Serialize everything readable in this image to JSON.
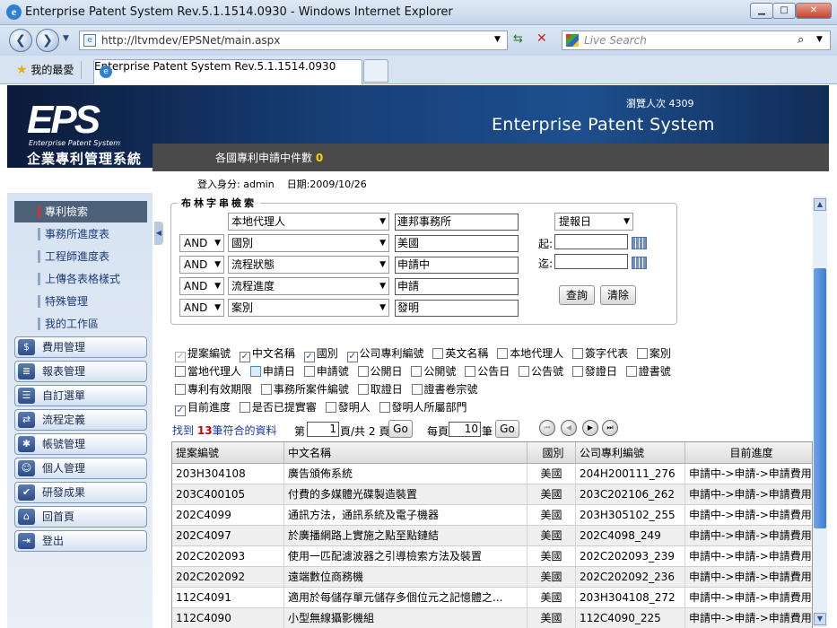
{
  "window": {
    "title": "Enterprise Patent System Rev.5.1.1514.0930 - Windows Internet Explorer",
    "url": "http://ltvmdev/EPSNet/main.aspx",
    "search_placeholder": "Live Search",
    "favorites_label": "我的最愛",
    "tab_title": "Enterprise Patent System Rev.5.1.1514.0930"
  },
  "header": {
    "logo_text": "EPS",
    "logo_subtitle": "Enterprise Patent System",
    "system_name_cn": "企業專利管理系統",
    "visits_label": "瀏覽人次",
    "visits_count": "4309",
    "system_name_en": "Enterprise Patent System",
    "apply_label": "各國專利申請中件數",
    "apply_count": "0",
    "login_label": "登入身分:",
    "login_user": "admin",
    "date_label": "日期:",
    "date_value": "2009/10/26"
  },
  "sidebar": {
    "sub_items": [
      "專利檢索",
      "事務所進度表",
      "工程師進度表",
      "上傳各表格樣式",
      "特殊管理",
      "我的工作區"
    ],
    "main_items": [
      {
        "label": "費用管理",
        "icon": "dollar-icon"
      },
      {
        "label": "報表管理",
        "icon": "report-icon"
      },
      {
        "label": "自訂選單",
        "icon": "custom-menu-icon"
      },
      {
        "label": "流程定義",
        "icon": "flow-icon"
      },
      {
        "label": "帳號管理",
        "icon": "account-icon"
      },
      {
        "label": "個人管理",
        "icon": "person-icon"
      },
      {
        "label": "研發成果",
        "icon": "thumbs-up-icon"
      },
      {
        "label": "回首頁",
        "icon": "home-icon"
      },
      {
        "label": "登出",
        "icon": "logout-icon"
      }
    ]
  },
  "search": {
    "title": "布林字串檢索",
    "rows": [
      {
        "op": "",
        "field": "本地代理人",
        "value": "連邦事務所"
      },
      {
        "op": "AND",
        "field": "國別",
        "value": "美國"
      },
      {
        "op": "AND",
        "field": "流程狀態",
        "value": "申請中"
      },
      {
        "op": "AND",
        "field": "流程進度",
        "value": "申請"
      },
      {
        "op": "AND",
        "field": "案別",
        "value": "發明"
      }
    ],
    "date_field": "提報日",
    "from_label": "起:",
    "to_label": "迄:",
    "query_button": "查詢",
    "clear_button": "清除"
  },
  "columns_options": [
    {
      "label": "提案編號",
      "checked": true,
      "disabled": true
    },
    {
      "label": "中文名稱",
      "checked": true
    },
    {
      "label": "國別",
      "checked": true
    },
    {
      "label": "公司專利編號",
      "checked": true
    },
    {
      "label": "英文名稱",
      "checked": false
    },
    {
      "label": "本地代理人",
      "checked": false
    },
    {
      "label": "簽字代表",
      "checked": false
    },
    {
      "label": "案別",
      "checked": false
    },
    {
      "label": "當地代理人",
      "checked": false
    },
    {
      "label": "申請日",
      "checked": false,
      "highlight": true
    },
    {
      "label": "申請號",
      "checked": false
    },
    {
      "label": "公開日",
      "checked": false
    },
    {
      "label": "公開號",
      "checked": false
    },
    {
      "label": "公告日",
      "checked": false
    },
    {
      "label": "公告號",
      "checked": false
    },
    {
      "label": "發證日",
      "checked": false
    },
    {
      "label": "證書號",
      "checked": false
    },
    {
      "label": "專利有效期限",
      "checked": false
    },
    {
      "label": "事務所案件編號",
      "checked": false
    },
    {
      "label": "取證日",
      "checked": false
    },
    {
      "label": "證書卷宗號",
      "checked": false
    },
    {
      "label": "目前進度",
      "checked": true
    },
    {
      "label": "是否已提實審",
      "checked": false
    },
    {
      "label": "發明人",
      "checked": false
    },
    {
      "label": "發明人所屬部門",
      "checked": false
    }
  ],
  "results": {
    "found_prefix": "找到",
    "found_count": "13",
    "found_suffix": "筆符合的資料",
    "page_prefix": "第",
    "page_value": "1",
    "page_mid": "頁/共",
    "page_total": "2",
    "page_suffix": "頁",
    "go_label": "Go",
    "per_prefix": "每頁",
    "per_value": "10",
    "per_suffix": "筆",
    "headers": [
      "提案編號",
      "中文名稱",
      "國別",
      "公司專利編號",
      "目前進度"
    ],
    "rows": [
      [
        "203H304108",
        "廣告頒佈系統",
        "美國",
        "204H200111_276",
        "申請中->申請->申請費用"
      ],
      [
        "203C400105",
        "付費的多媒體光碟製造裝置",
        "美國",
        "203C202106_262",
        "申請中->申請->申請費用"
      ],
      [
        "202C4099",
        "通訊方法，通訊系統及電子機器",
        "美國",
        "203H305102_255",
        "申請中->申請->申請費用"
      ],
      [
        "202C4097",
        "於廣播網路上實施之點至點鏈結",
        "美國",
        "202C4098_249",
        "申請中->申請->申請費用"
      ],
      [
        "202C202093",
        "使用一匹配濾波器之引導檢索方法及裝置",
        "美國",
        "202C202093_239",
        "申請中->申請->申請費用"
      ],
      [
        "202C202092",
        "遠端數位商務機",
        "美國",
        "202C202092_236",
        "申請中->申請->申請費用"
      ],
      [
        "112C4091",
        "適用於每儲存單元儲存多個位元之記憶體之...",
        "美國",
        "203H304108_272",
        "申請中->申請->申請費用"
      ],
      [
        "112C4090",
        "小型無線攝影機組",
        "美國",
        "112C4090_225",
        "申請中->申請->申請費用"
      ]
    ]
  }
}
